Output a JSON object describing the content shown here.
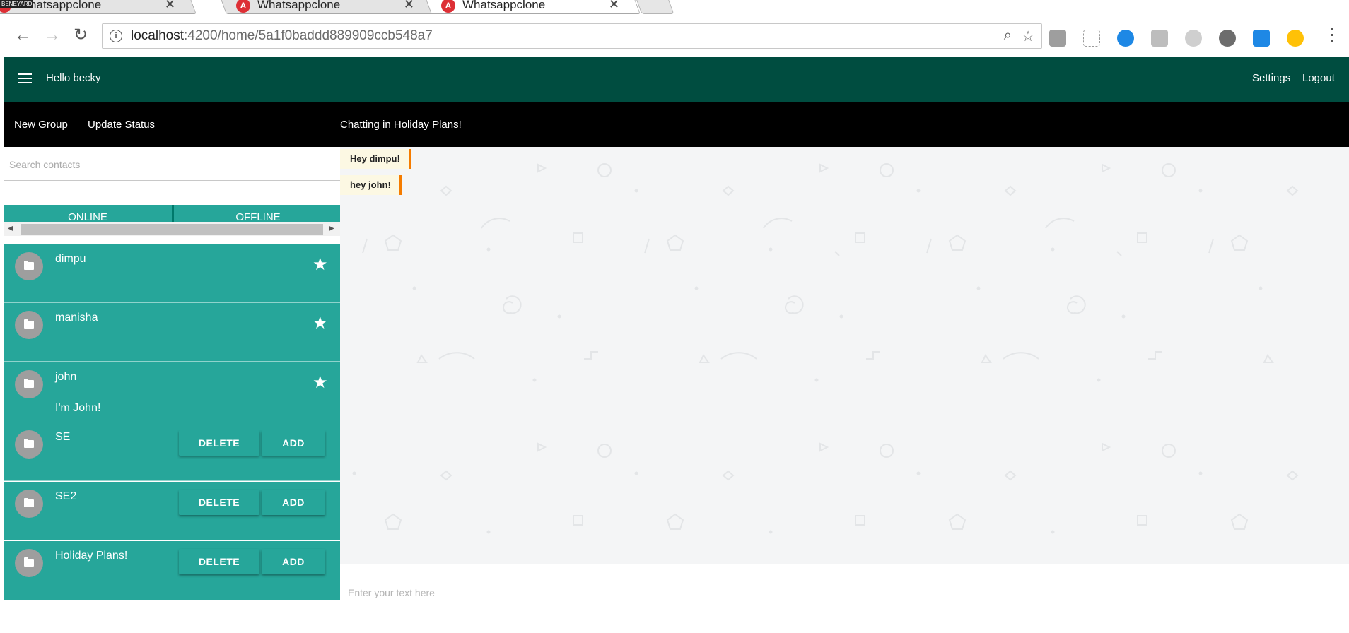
{
  "browser": {
    "watermark": "BENEYARD",
    "tabs": [
      {
        "title": "Whatsappclone",
        "close": "✕"
      },
      {
        "title": "Whatsappclone",
        "close": "✕"
      },
      {
        "title": "Whatsappclone",
        "close": "✕"
      }
    ],
    "tab_icon": "A",
    "url_host": "localhost",
    "url_rest": ":4200/home/5a1f0baddd889909ccb548a7",
    "icons": {
      "back": "←",
      "forward": "→",
      "reload": "↻",
      "info": "i",
      "zoom": "⌕",
      "bookmark": "☆",
      "menu": "⋮"
    }
  },
  "app": {
    "greeting": "Hello becky",
    "settings_label": "Settings",
    "logout_label": "Logout",
    "new_group_label": "New Group",
    "update_status_label": "Update Status",
    "chat_title": "Chatting in Holiday Plans!",
    "search_placeholder": "Search contacts",
    "tabs": [
      "ONLINE",
      "OFFLINE"
    ],
    "contacts": [
      {
        "name": "dimpu",
        "status": "",
        "favorite": true
      },
      {
        "name": "manisha",
        "status": "",
        "favorite": true
      },
      {
        "name": "john",
        "status": "I'm John!",
        "favorite": true
      }
    ],
    "groups": [
      {
        "name": "SE",
        "delete_label": "DELETE",
        "add_label": "ADD"
      },
      {
        "name": "SE2",
        "delete_label": "DELETE",
        "add_label": "ADD"
      },
      {
        "name": "Holiday Plans!",
        "delete_label": "DELETE",
        "add_label": "ADD"
      }
    ],
    "messages": [
      "Hey dimpu!",
      "hey john!"
    ],
    "message_placeholder": "Enter your text here",
    "star_glyph": "★"
  },
  "colors": {
    "appbar": "#004d40",
    "subbar": "#000000",
    "teal": "#26a69a",
    "message_bg": "#fcf8e3",
    "message_accent": "#f57c00"
  }
}
